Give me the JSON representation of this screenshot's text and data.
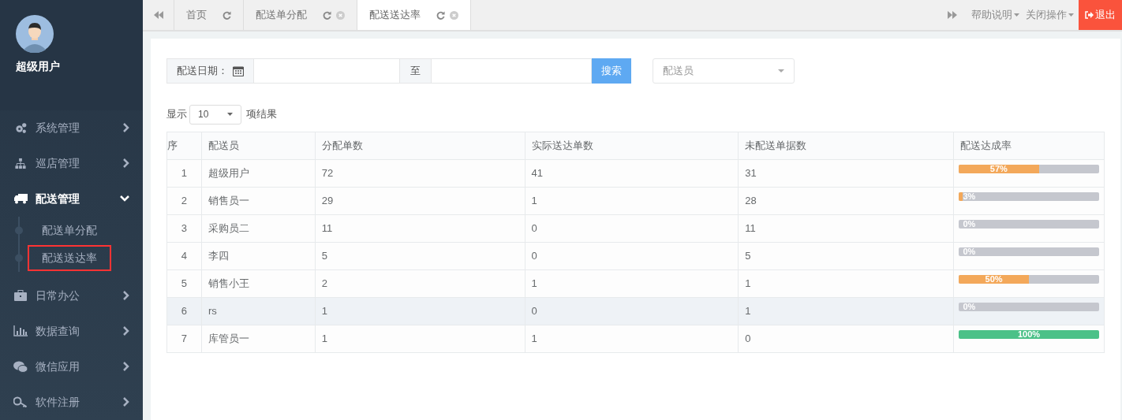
{
  "user": {
    "name": "超级用户"
  },
  "menu": [
    {
      "label": "系统管理",
      "expanded": false
    },
    {
      "label": "巡店管理",
      "expanded": false
    },
    {
      "label": "配送管理",
      "expanded": true,
      "children": [
        {
          "label": "配送单分配",
          "highlighted": false
        },
        {
          "label": "配送送达率",
          "highlighted": true
        }
      ]
    },
    {
      "label": "日常办公",
      "expanded": false
    },
    {
      "label": "数据查询",
      "expanded": false
    },
    {
      "label": "微信应用",
      "expanded": false
    },
    {
      "label": "软件注册",
      "expanded": false
    }
  ],
  "tabs": [
    {
      "label": "首页",
      "selected": false,
      "closable": false
    },
    {
      "label": "配送单分配",
      "selected": false,
      "closable": true
    },
    {
      "label": "配送送达率",
      "selected": true,
      "closable": true
    }
  ],
  "top_actions": [
    {
      "label": "帮助说明"
    },
    {
      "label": "关闭操作"
    }
  ],
  "logout": "退出",
  "filter": {
    "date_label": "配送日期：",
    "to_label": "至",
    "search_button": "搜索",
    "courier_placeholder": "配送员"
  },
  "page_size": {
    "prefix": "显示",
    "value": "10",
    "suffix": "项结果"
  },
  "table": {
    "columns": [
      "序",
      "配送员",
      "分配单数",
      "实际送达单数",
      "未配送单据数",
      "配送达成率"
    ],
    "rows": [
      {
        "cells": [
          "1",
          "超级用户",
          "72",
          "41",
          "31"
        ],
        "level": 0.57,
        "reading": "57%",
        "hovered": false
      },
      {
        "cells": [
          "2",
          "销售员一",
          "29",
          "1",
          "28"
        ],
        "level": 0.03,
        "reading": "3%",
        "hovered": false
      },
      {
        "cells": [
          "3",
          "采购员二",
          "11",
          "0",
          "11"
        ],
        "level": 0,
        "reading": "0%",
        "hovered": false
      },
      {
        "cells": [
          "4",
          "李四",
          "5",
          "0",
          "5"
        ],
        "level": 0,
        "reading": "0%",
        "hovered": false
      },
      {
        "cells": [
          "5",
          "销售小王",
          "2",
          "1",
          "1"
        ],
        "level": 0.5,
        "reading": "50%",
        "hovered": false
      },
      {
        "cells": [
          "6",
          "rs",
          "1",
          "0",
          "1"
        ],
        "level": 0,
        "reading": "0%",
        "hovered": true
      },
      {
        "cells": [
          "7",
          "库管员一",
          "1",
          "1",
          "0"
        ],
        "level": 1,
        "reading": "100%",
        "hovered": false
      }
    ]
  }
}
